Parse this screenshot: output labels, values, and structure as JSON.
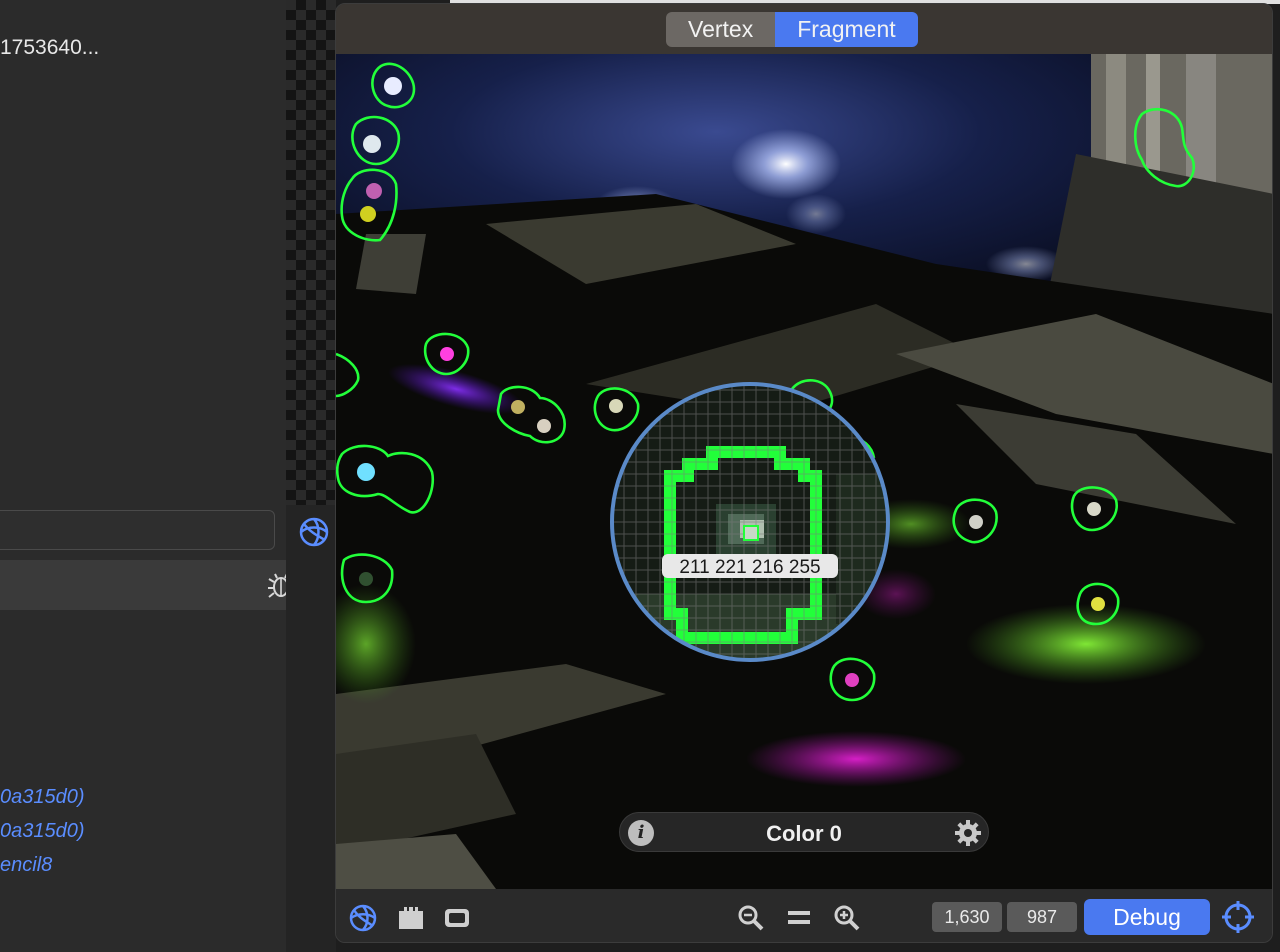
{
  "left_panel": {
    "item_text": "1753640...",
    "links": [
      "0a315d0)",
      "0a315d0)",
      "encil8"
    ]
  },
  "viewer": {
    "tabs": [
      {
        "label": "Vertex",
        "active": false
      },
      {
        "label": "Fragment",
        "active": true
      }
    ],
    "magnifier_readout": "211 221 216 255",
    "color_attachment_label": "Color 0",
    "width_value": "1,630",
    "height_value": "987",
    "debug_label": "Debug",
    "accent_color": "#4a79f0",
    "outline_color": "#22ff3a"
  },
  "icons": {
    "left_row": "bug-icon",
    "strip": "shader-icon",
    "footer_left": [
      "shader-icon",
      "castle-icon",
      "frame-icon"
    ],
    "zoom": [
      "zoom-out-icon",
      "zoom-actual-icon",
      "zoom-in-icon"
    ],
    "pill": [
      "info-icon",
      "gear-icon"
    ],
    "footer_right": "crosshair-icon"
  }
}
